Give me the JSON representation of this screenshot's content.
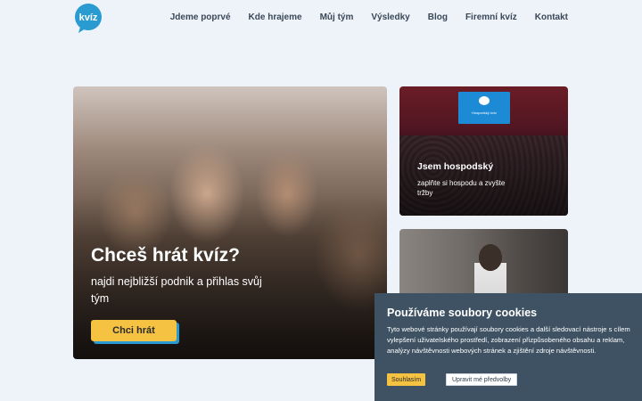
{
  "logo": {
    "text": "kvíz",
    "color": "#2a9bd1"
  },
  "nav": {
    "items": [
      {
        "label": "Jdeme poprvé"
      },
      {
        "label": "Kde hrajeme"
      },
      {
        "label": "Můj tým"
      },
      {
        "label": "Výsledky"
      },
      {
        "label": "Blog"
      },
      {
        "label": "Firemní kvíz"
      },
      {
        "label": "Kontakt"
      }
    ]
  },
  "hero": {
    "title": "Chceš hrát kvíz?",
    "subtitle": "najdi nejbližší podnik a přihlas svůj tým",
    "cta_label": "Chci hrát",
    "cta_color": "#f5c242",
    "cta_shadow": "#2a9bd1"
  },
  "cards": [
    {
      "title": "Jsem hospodský",
      "text": "zaplňte si hospodu a zvyšte tržby",
      "screen_text": "Hospodský kvíz"
    },
    {
      "title": "",
      "text": ""
    }
  ],
  "cookie": {
    "title": "Používáme soubory cookies",
    "text": "Tyto webové stránky používají soubory cookies a další sledovací nástroje s cílem vylepšení uživatelského prostředí, zobrazení přizpůsobeného obsahu a reklam, analýzy návštěvnosti webových stránek a zjištění zdroje návštěvnosti.",
    "accept_label": "Souhlasím",
    "edit_label": "Upravit mé předvolby",
    "background": "#3e5263"
  }
}
